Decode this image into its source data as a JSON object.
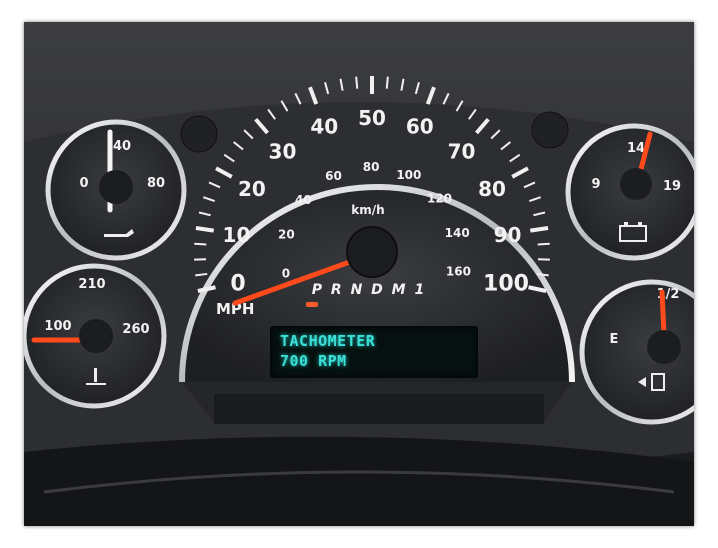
{
  "speedometer": {
    "mph_ticks": [
      "0",
      "10",
      "20",
      "30",
      "40",
      "50",
      "60",
      "70",
      "80",
      "90",
      "100"
    ],
    "kmh_ticks": [
      "0",
      "20",
      "40",
      "60",
      "80",
      "100",
      "120",
      "140",
      "160"
    ],
    "mph_unit": "MPH",
    "kmh_unit": "km/h",
    "gear_indicator": "P R N D M 1"
  },
  "oil_gauge": {
    "labels": [
      "0",
      "40",
      "80"
    ],
    "icon": "oil-can-icon"
  },
  "temp_gauge": {
    "labels": [
      "100",
      "210",
      "260"
    ],
    "icon": "coolant-temperature-icon"
  },
  "volt_gauge": {
    "labels": [
      "9",
      "14",
      "19"
    ],
    "icon": "battery-icon"
  },
  "fuel_gauge": {
    "labels": [
      "E",
      "1/2"
    ],
    "icon": "fuel-pump-icon"
  },
  "display": {
    "line1": "TACHOMETER",
    "line2": "700 RPM"
  },
  "colors": {
    "needle": "#ff4a1c",
    "lcd_text": "#3ce0d6",
    "chrome": "#d7d9dc"
  },
  "readings": {
    "speed_mph": 0
  }
}
